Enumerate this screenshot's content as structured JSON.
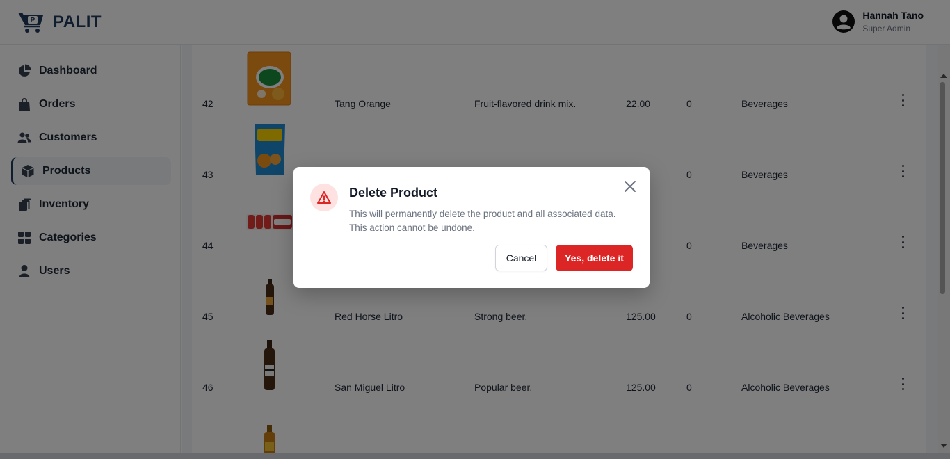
{
  "brand": {
    "name": "PALIT",
    "logo_icon": "cart-icon"
  },
  "user": {
    "name": "Hannah Tano",
    "role": "Super Admin",
    "avatar_icon": "user-circle-icon"
  },
  "sidebar": {
    "items": [
      {
        "label": "Dashboard",
        "icon": "pie-chart-icon",
        "active": false
      },
      {
        "label": "Orders",
        "icon": "shopping-bag-icon",
        "active": false
      },
      {
        "label": "Customers",
        "icon": "users-icon",
        "active": false
      },
      {
        "label": "Products",
        "icon": "cube-icon",
        "active": true
      },
      {
        "label": "Inventory",
        "icon": "boxes-icon",
        "active": false
      },
      {
        "label": "Categories",
        "icon": "grid-icon",
        "active": false
      },
      {
        "label": "Users",
        "icon": "user-icon",
        "active": false
      }
    ]
  },
  "products": {
    "rows": [
      {
        "id": "42",
        "name": "Tang Orange",
        "description": "Fruit-flavored drink mix.",
        "price": "22.00",
        "stock": "0",
        "category": "Beverages",
        "image": "tang-orange-pack"
      },
      {
        "id": "43",
        "name": "",
        "description": "",
        "price": "",
        "stock": "0",
        "category": "Beverages",
        "image": "zesto-orange-pouch"
      },
      {
        "id": "44",
        "name": "",
        "description": "",
        "price": "",
        "stock": "0",
        "category": "Beverages",
        "image": "yakult-bottles"
      },
      {
        "id": "45",
        "name": "Red Horse Litro",
        "description": "Strong beer.",
        "price": "125.00",
        "stock": "0",
        "category": "Alcoholic Beverages",
        "image": "red-horse-bottle"
      },
      {
        "id": "46",
        "name": "San Miguel Litro",
        "description": "Popular beer.",
        "price": "125.00",
        "stock": "0",
        "category": "Alcoholic Beverages",
        "image": "san-miguel-bottle"
      },
      {
        "id": "",
        "name": "",
        "description": "",
        "price": "",
        "stock": "",
        "category": "",
        "image": "beer-bottle"
      }
    ]
  },
  "dialog": {
    "title": "Delete Product",
    "message_line1": "This will permanently delete the product and all associated data.",
    "message_line2": "This action cannot be undone.",
    "cancel_label": "Cancel",
    "confirm_label": "Yes, delete it",
    "icon": "warning-triangle-icon",
    "close_icon": "close-icon"
  },
  "colors": {
    "brand": "#1e3a5f",
    "danger": "#dc2626",
    "danger_soft": "#fee2e2",
    "overlay": "#000000"
  }
}
